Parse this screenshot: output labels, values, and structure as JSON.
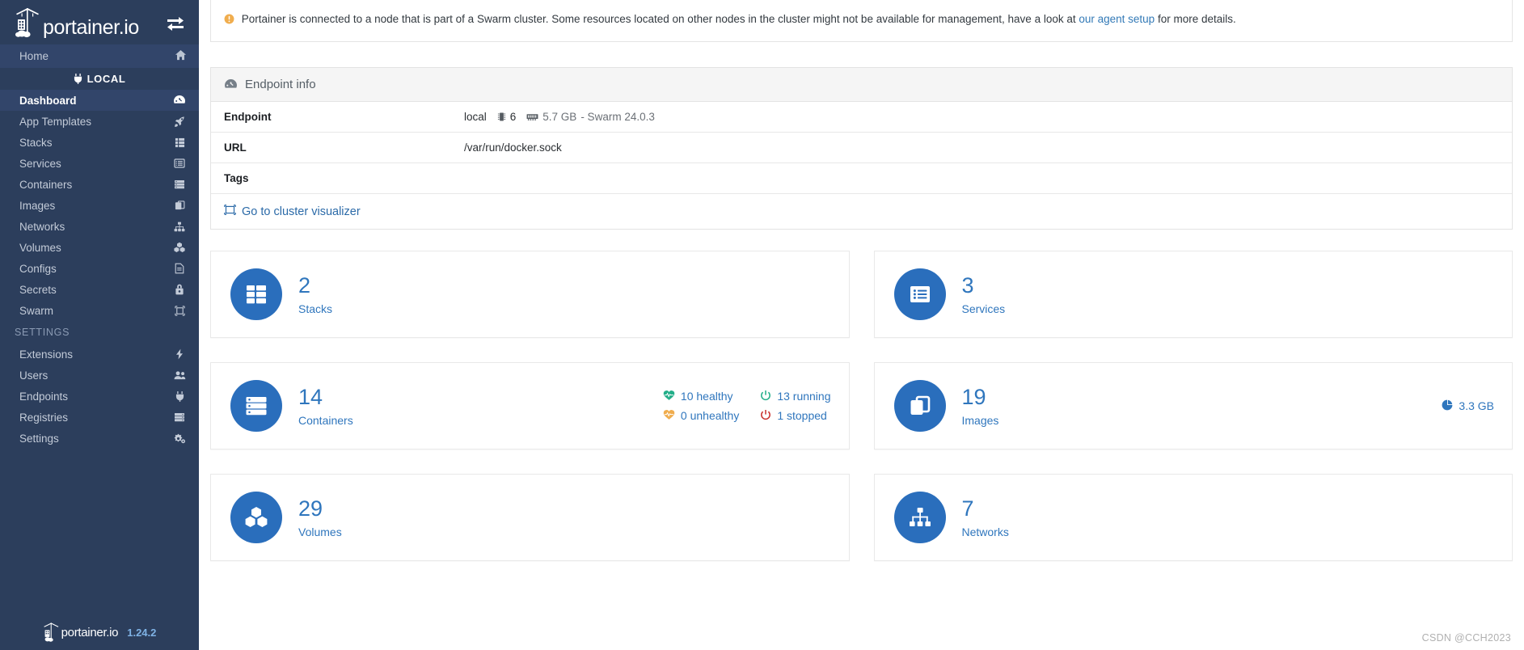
{
  "sidebar": {
    "brand": "portainer.io",
    "sync_icon": "sync-arrows-icon",
    "home": {
      "label": "Home",
      "icon": "home-icon"
    },
    "local_header": {
      "label": "LOCAL",
      "icon": "plug-icon"
    },
    "items": [
      {
        "label": "Dashboard",
        "icon": "dashboard-icon",
        "active": true
      },
      {
        "label": "App Templates",
        "icon": "rocket-icon",
        "active": false
      },
      {
        "label": "Stacks",
        "icon": "stacks-icon",
        "active": false
      },
      {
        "label": "Services",
        "icon": "services-icon",
        "active": false
      },
      {
        "label": "Containers",
        "icon": "containers-icon",
        "active": false
      },
      {
        "label": "Images",
        "icon": "images-icon",
        "active": false
      },
      {
        "label": "Networks",
        "icon": "networks-icon",
        "active": false
      },
      {
        "label": "Volumes",
        "icon": "volumes-icon",
        "active": false
      },
      {
        "label": "Configs",
        "icon": "configs-icon",
        "active": false
      },
      {
        "label": "Secrets",
        "icon": "secrets-icon",
        "active": false
      },
      {
        "label": "Swarm",
        "icon": "swarm-icon",
        "active": false
      }
    ],
    "settings_header": "SETTINGS",
    "settings_items": [
      {
        "label": "Extensions",
        "icon": "bolt-icon"
      },
      {
        "label": "Users",
        "icon": "users-icon"
      },
      {
        "label": "Endpoints",
        "icon": "plug-icon"
      },
      {
        "label": "Registries",
        "icon": "registry-icon"
      },
      {
        "label": "Settings",
        "icon": "gears-icon"
      }
    ],
    "footer": {
      "brand": "portainer.io",
      "version": "1.24.2"
    }
  },
  "alert": {
    "icon": "warning-icon",
    "text_before": "Portainer is connected to a node that is part of a Swarm cluster. Some resources located on other nodes in the cluster might not be available for management, have a look at ",
    "link": "our agent setup",
    "text_after": " for more details."
  },
  "endpoint_panel": {
    "icon": "dashboard-icon",
    "title": "Endpoint info",
    "rows": [
      {
        "key": "Endpoint",
        "value": "local",
        "cpu": "6",
        "memory": "5.7 GB",
        "suffix": "- Swarm 24.0.3",
        "cpu_icon": "cpu-icon",
        "memory_icon": "memory-icon"
      },
      {
        "key": "URL",
        "value": "/var/run/docker.sock"
      },
      {
        "key": "Tags",
        "value": ""
      }
    ],
    "visualizer_link": {
      "label": "Go to cluster visualizer",
      "icon": "cluster-visualizer-icon"
    }
  },
  "cards": {
    "left": [
      {
        "number": "2",
        "label": "Stacks",
        "icon": "stacks-icon"
      },
      {
        "number": "14",
        "label": "Containers",
        "icon": "containers-icon",
        "stats": [
          {
            "text": "10 healthy",
            "icon": "heart-icon",
            "color": "#23ae89"
          },
          {
            "text": "0 unhealthy",
            "icon": "heart-icon",
            "color": "#f0ad4e"
          },
          {
            "text": "13 running",
            "icon": "power-icon",
            "color": "#23ae89"
          },
          {
            "text": "1 stopped",
            "icon": "power-icon",
            "color": "#c9302c"
          }
        ]
      },
      {
        "number": "29",
        "label": "Volumes",
        "icon": "volumes-icon"
      }
    ],
    "right": [
      {
        "number": "3",
        "label": "Services",
        "icon": "services-icon"
      },
      {
        "number": "19",
        "label": "Images",
        "icon": "images-icon",
        "size": "3.3 GB",
        "size_icon": "pie-chart-icon"
      },
      {
        "number": "7",
        "label": "Networks",
        "icon": "networks-icon"
      }
    ]
  },
  "watermark": "CSDN @CCH2023",
  "colors": {
    "sidebar_bg": "#2c3e5c",
    "sidebar_active": "#32456a",
    "accent_blue": "#2a6ebc",
    "text_blue": "#2f76bd",
    "link_blue": "#337ab7",
    "green": "#23ae89",
    "orange": "#f0ad4e",
    "red": "#c9302c"
  }
}
